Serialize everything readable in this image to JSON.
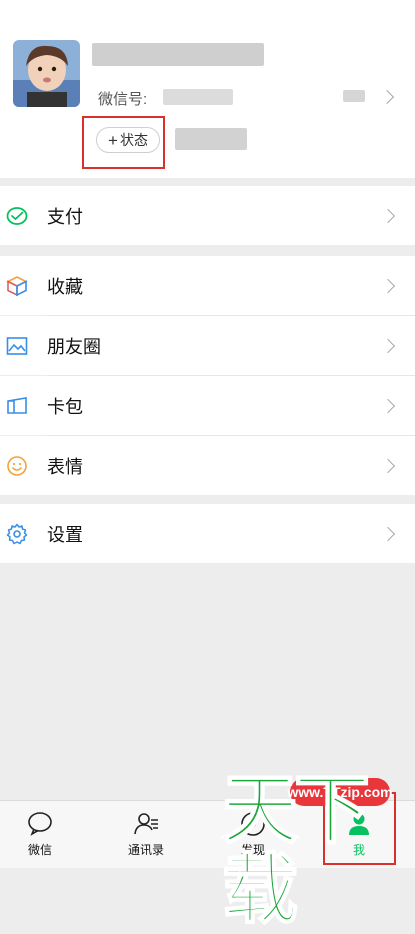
{
  "profile": {
    "wechat_id_label": "微信号:",
    "status_label": "状态",
    "status_plus": "+"
  },
  "menu": {
    "pay": "支付",
    "favorites": "收藏",
    "moments": "朋友圈",
    "cards": "卡包",
    "stickers": "表情",
    "settings": "设置"
  },
  "tabs": [
    {
      "label": "微信"
    },
    {
      "label": "通讯录"
    },
    {
      "label": "发现"
    },
    {
      "label": "我"
    }
  ],
  "watermark": {
    "url": "www.TTzip.com",
    "text": "天下载"
  },
  "colors": {
    "accent_green": "#07c160",
    "annotation_red": "#d8312c"
  }
}
